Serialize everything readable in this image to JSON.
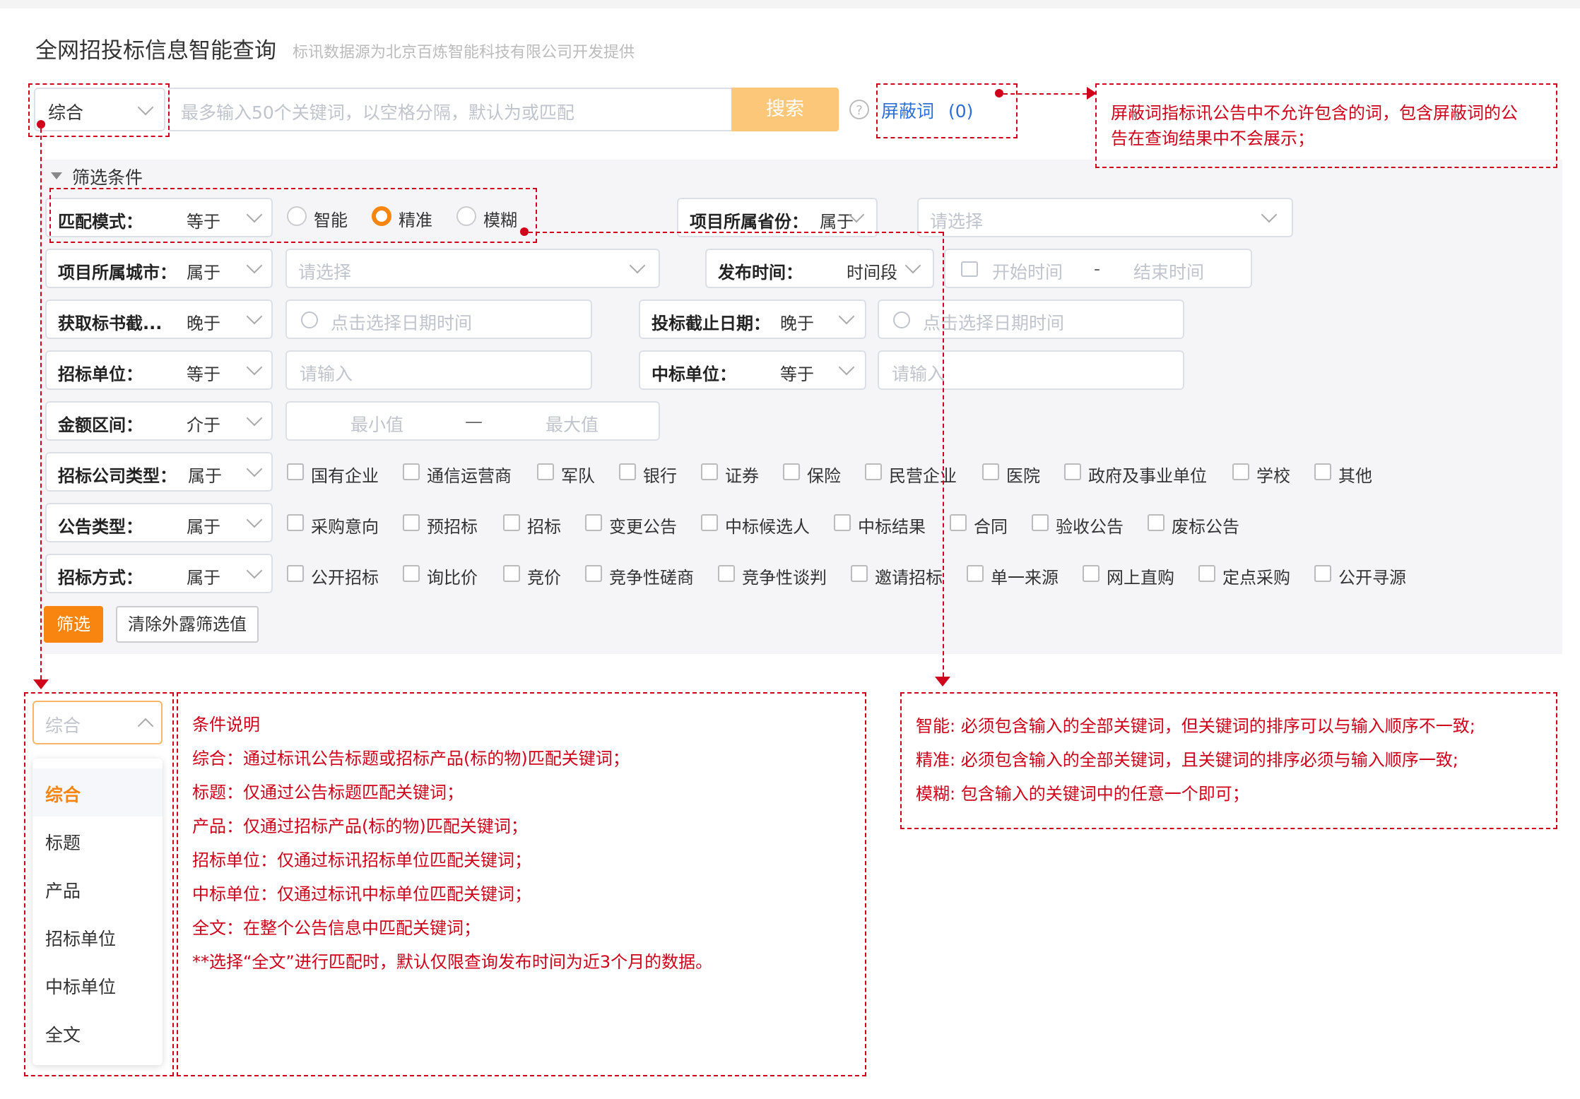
{
  "header": {
    "title": "全网招投标信息智能查询",
    "subtitle": "标讯数据源为北京百炼智能科技有限公司开发提供"
  },
  "search": {
    "scope_value": "综合",
    "placeholder": "最多输入50个关键词，以空格分隔，默认为或匹配",
    "button_label": "搜索",
    "help_icon": "?",
    "mask_words_label": "屏蔽词",
    "mask_words_count": "(0)"
  },
  "filters": {
    "section_title": "筛选条件",
    "match_mode": {
      "label": "匹配模式：",
      "op": "等于",
      "options": [
        "智能",
        "精准",
        "模糊"
      ],
      "selected": "精准"
    },
    "province": {
      "label": "项目所属省份：",
      "op": "属于",
      "placeholder": "请选择"
    },
    "city": {
      "label": "项目所属城市：",
      "op": "属于",
      "placeholder": "请选择"
    },
    "publish_time": {
      "label": "发布时间：",
      "op": "时间段",
      "start_placeholder": "开始时间",
      "separator": "-",
      "end_placeholder": "结束时间"
    },
    "doc_deadline": {
      "label": "获取标书截...",
      "op": "晚于",
      "placeholder": "点击选择日期时间"
    },
    "bid_deadline": {
      "label": "投标截止日期：",
      "op": "晚于",
      "placeholder": "点击选择日期时间"
    },
    "tenderer": {
      "label": "招标单位：",
      "op": "等于",
      "placeholder": "请输入"
    },
    "winner": {
      "label": "中标单位：",
      "op": "等于",
      "placeholder": "请输入"
    },
    "amount": {
      "label": "金额区间：",
      "op": "介于",
      "min_placeholder": "最小值",
      "separator": "—",
      "max_placeholder": "最大值"
    },
    "company_type": {
      "label": "招标公司类型：",
      "op": "属于",
      "options": [
        "国有企业",
        "通信运营商",
        "军队",
        "银行",
        "证券",
        "保险",
        "民营企业",
        "医院",
        "政府及事业单位",
        "学校",
        "其他"
      ]
    },
    "notice_type": {
      "label": "公告类型：",
      "op": "属于",
      "options": [
        "采购意向",
        "预招标",
        "招标",
        "变更公告",
        "中标候选人",
        "中标结果",
        "合同",
        "验收公告",
        "废标公告"
      ]
    },
    "bid_method": {
      "label": "招标方式：",
      "op": "属于",
      "options": [
        "公开招标",
        "询比价",
        "竞价",
        "竞争性磋商",
        "竞争性谈判",
        "邀请招标",
        "单一来源",
        "网上直购",
        "定点采购",
        "公开寻源"
      ]
    },
    "filter_button": "筛选",
    "clear_button": "清除外露筛选值"
  },
  "dropdown": {
    "value": "综合",
    "items": [
      "综合",
      "标题",
      "产品",
      "招标单位",
      "中标单位",
      "全文"
    ],
    "active": "综合"
  },
  "annotations": {
    "mask_note": [
      "屏蔽词指标讯公告中不允许包含的词，包含屏蔽词的公",
      "告在查询结果中不会展示；"
    ],
    "condition_note": [
      "条件说明",
      "综合：通过标讯公告标题或招标产品(标的物)匹配关键词；",
      "标题：仅通过公告标题匹配关键词；",
      "产品：仅通过招标产品(标的物)匹配关键词；",
      "招标单位：仅通过标讯招标单位匹配关键词；",
      "中标单位：仅通过标讯中标单位匹配关键词；",
      "全文：在整个公告信息中匹配关键词；",
      "**选择“全文”进行匹配时，默认仅限查询发布时间为近3个月的数据。"
    ],
    "match_note": [
      "智能: 必须包含输入的全部关键词，但关键词的排序可以与输入顺序不一致;",
      "精准: 必须包含输入的全部关键词，且关键词的排序必须与输入顺序一致;",
      "模糊: 包含输入的关键词中的任意一个即可；"
    ],
    "accent_color": "#d0021b"
  },
  "theme": {
    "primary": "#f7850f",
    "search_button": "#fdc77a",
    "link": "#2b6fd6"
  }
}
